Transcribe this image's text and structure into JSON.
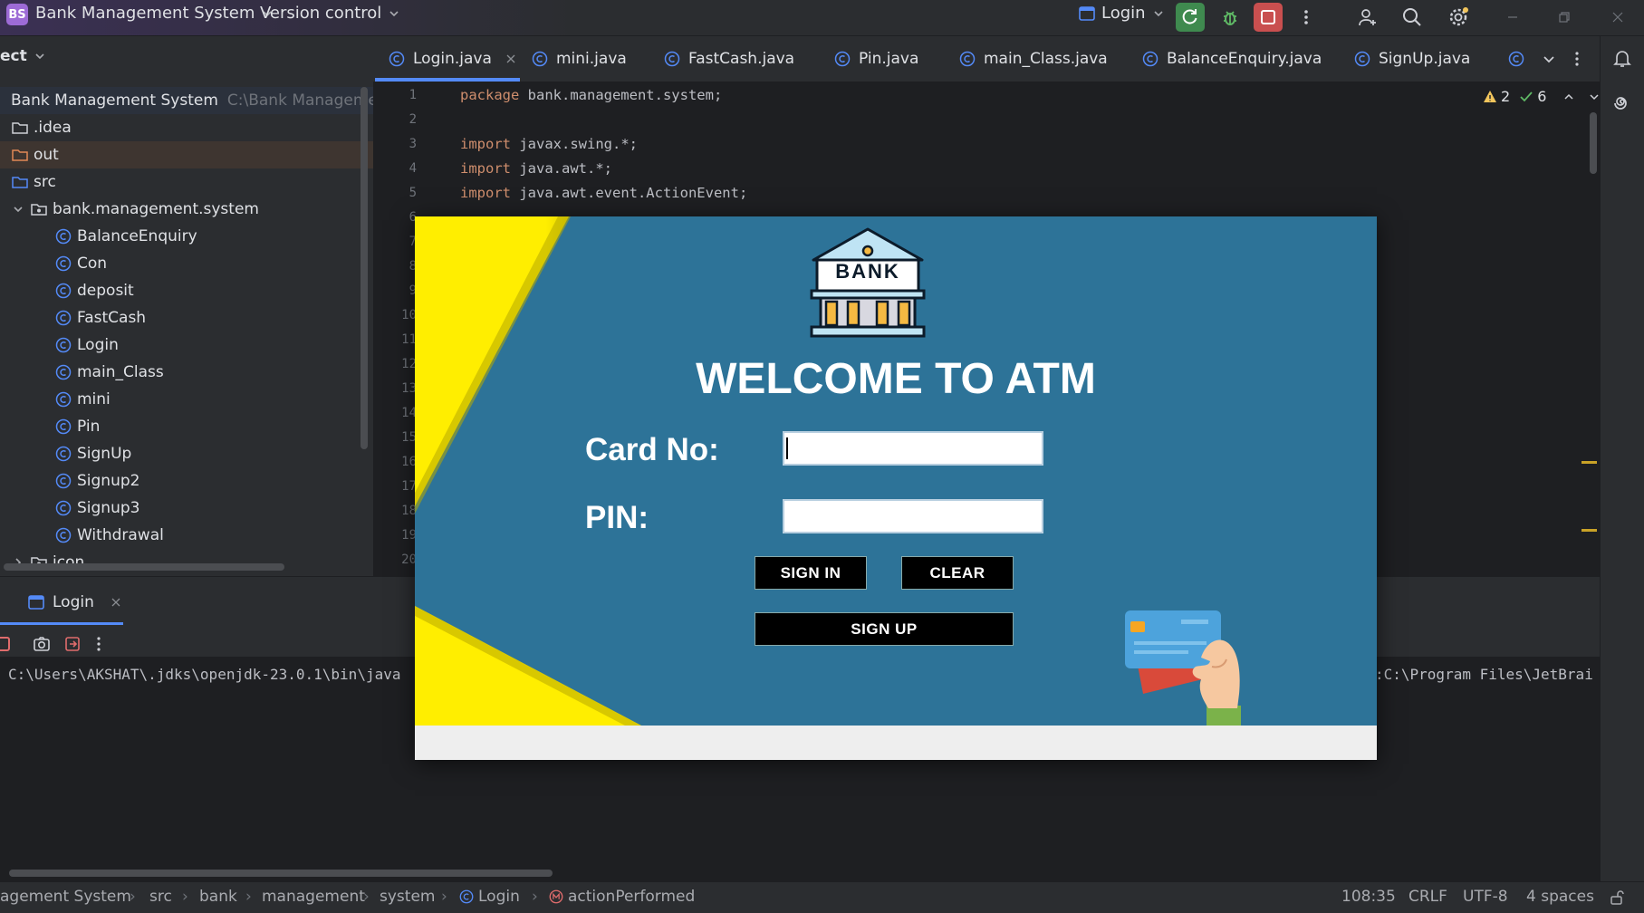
{
  "titlebar": {
    "project_badge": "BS",
    "project_name": "Bank Management System",
    "vcs": "Version control",
    "run_config": "Login"
  },
  "project_panel": {
    "header": "ect",
    "root_name": "Bank Management System",
    "root_path": "C:\\Bank Management",
    "items": [
      {
        "label": ".idea"
      },
      {
        "label": "out"
      },
      {
        "label": "src"
      },
      {
        "label": "bank.management.system"
      },
      {
        "label": "BalanceEnquiry"
      },
      {
        "label": "Con"
      },
      {
        "label": "deposit"
      },
      {
        "label": "FastCash"
      },
      {
        "label": "Login"
      },
      {
        "label": "main_Class"
      },
      {
        "label": "mini"
      },
      {
        "label": "Pin"
      },
      {
        "label": "SignUp"
      },
      {
        "label": "Signup2"
      },
      {
        "label": "Signup3"
      },
      {
        "label": "Withdrawal"
      },
      {
        "label": "icon"
      }
    ]
  },
  "tabs": [
    {
      "label": "Login.java"
    },
    {
      "label": "mini.java"
    },
    {
      "label": "FastCash.java"
    },
    {
      "label": "Pin.java"
    },
    {
      "label": "main_Class.java"
    },
    {
      "label": "BalanceEnquiry.java"
    },
    {
      "label": "SignUp.java"
    }
  ],
  "editor": {
    "warnings": "2",
    "checks": "6",
    "line_numbers": [
      "1",
      "2",
      "3",
      "4",
      "5",
      "6",
      "7",
      "8",
      "9",
      "10",
      "11",
      "12",
      "13",
      "14",
      "15",
      "16",
      "17",
      "18",
      "19",
      "20"
    ],
    "lines": [
      {
        "kw": "package",
        "rest": " bank.management.system;"
      },
      {
        "kw": "import",
        "rest": " javax.swing.*;"
      },
      {
        "kw": "import",
        "rest": " java.awt.*;"
      },
      {
        "kw": "import",
        "rest": " java.awt.event.ActionEvent;"
      }
    ]
  },
  "run_panel": {
    "tab_label": "Login",
    "console_left": "C:\\Users\\AKSHAT\\.jdks\\openjdk-23.0.1\\bin\\java",
    "console_right": ":C:\\Program Files\\JetBrai"
  },
  "statusbar": {
    "crumbs": [
      "agement System",
      "src",
      "bank",
      "management",
      "system",
      "Login",
      "actionPerformed"
    ],
    "position": "108:35",
    "line_sep": "CRLF",
    "encoding": "UTF-8",
    "indent": "4 spaces"
  },
  "atm": {
    "logo_text": "BANK",
    "title": "WELCOME TO ATM",
    "card_label": "Card No:",
    "card_value": "",
    "pin_label": "PIN:",
    "pin_value": "",
    "sign_in": "SIGN IN",
    "clear": "CLEAR",
    "sign_up": "SIGN UP",
    "colors": {
      "background": "#2d7398",
      "accent": "#ffee00",
      "button": "#000000"
    }
  }
}
